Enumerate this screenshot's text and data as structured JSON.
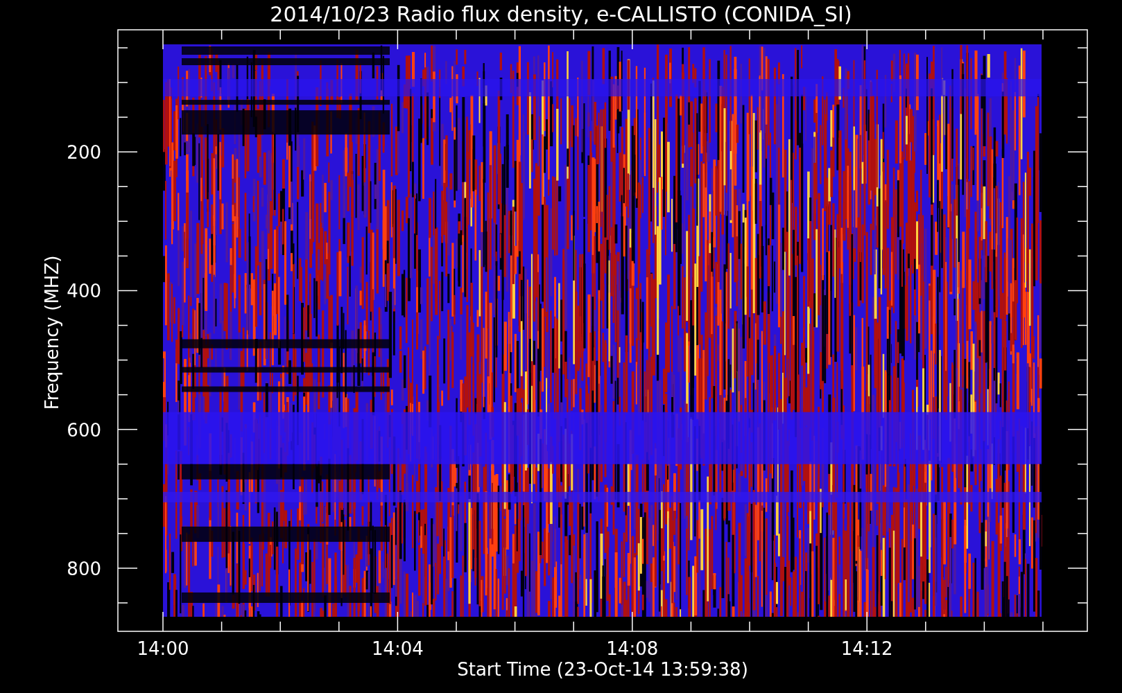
{
  "plot": {
    "title": "2014/10/23  Radio flux density, e-CALLISTO (CONIDA_SI)",
    "ylabel": "Frequency (MHZ)",
    "xlabel": "Start Time (23-Oct-14 13:59:38)",
    "y_tick_labels": [
      "200",
      "400",
      "600",
      "800"
    ],
    "x_tick_labels": [
      "14:00",
      "14:04",
      "14:08",
      "14:12"
    ]
  }
}
